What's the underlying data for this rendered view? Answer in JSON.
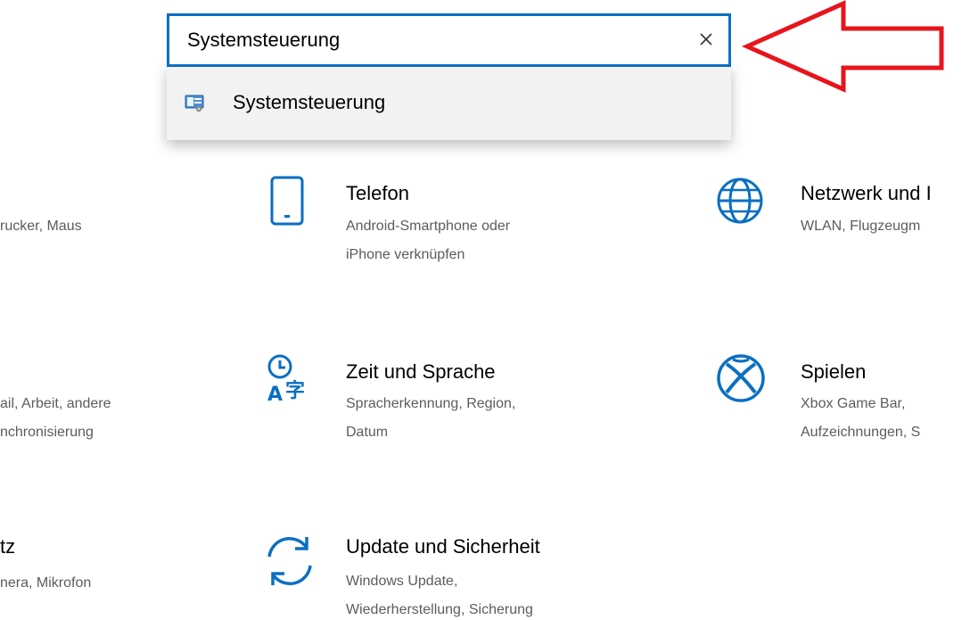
{
  "search": {
    "value": "Systemsteuerung",
    "clear_icon": "close-icon"
  },
  "dropdown": {
    "items": [
      {
        "label": "Systemsteuerung",
        "icon": "control-panel-icon"
      }
    ]
  },
  "annotation": {
    "type": "arrow",
    "color": "#e8141c"
  },
  "accent_color": "#0a6fc2",
  "tiles": {
    "devices": {
      "desc_line1": "rucker, Maus"
    },
    "telefon": {
      "title": "Telefon",
      "desc_line1": "Android-Smartphone oder",
      "desc_line2": "iPhone verknüpfen",
      "icon": "phone-icon"
    },
    "netzwerk": {
      "title": "Netzwerk und I",
      "desc_line1": "WLAN, Flugzeugm",
      "icon": "globe-icon"
    },
    "konten": {
      "desc_line1": "ail, Arbeit, andere",
      "desc_line2": "nchronisierung"
    },
    "zeit": {
      "title": "Zeit und Sprache",
      "desc_line1": "Spracherkennung, Region,",
      "desc_line2": "Datum",
      "icon": "time-language-icon"
    },
    "spielen": {
      "title": "Spielen",
      "desc_line1": "Xbox Game Bar,",
      "desc_line2": "Aufzeichnungen, S",
      "icon": "xbox-icon"
    },
    "datenschutz": {
      "title": "tz",
      "desc_line1": "nera, Mikrofon"
    },
    "update": {
      "title": "Update und Sicherheit",
      "desc_line1": "Windows Update,",
      "desc_line2": "Wiederherstellung, Sicherung",
      "icon": "sync-icon"
    }
  }
}
